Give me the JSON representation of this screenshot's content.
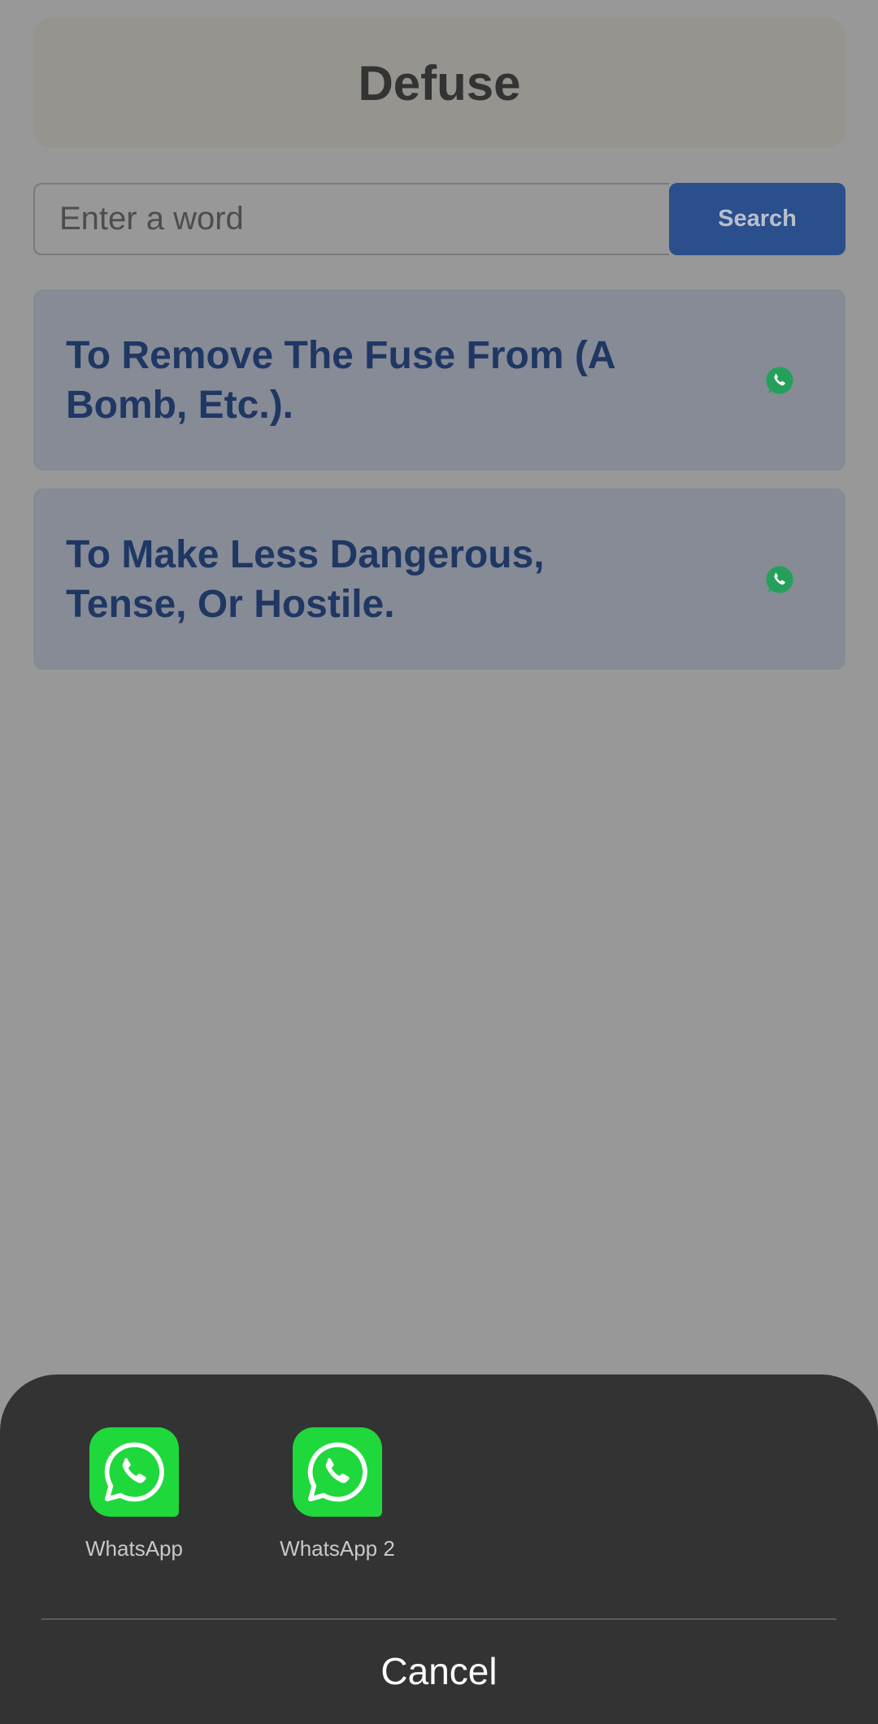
{
  "header": {
    "title": "Defuse"
  },
  "search": {
    "placeholder": "Enter a word",
    "value": "",
    "button_label": "Search"
  },
  "definitions": [
    {
      "text": "To Remove The Fuse From (A Bomb, Etc.).",
      "share_icon": "whatsapp-icon"
    },
    {
      "text": "To Make Less Dangerous, Tense, Or Hostile.",
      "share_icon": "whatsapp-icon"
    }
  ],
  "share_sheet": {
    "targets": [
      {
        "label": "WhatsApp",
        "icon": "whatsapp-icon"
      },
      {
        "label": "WhatsApp 2",
        "icon": "whatsapp-icon"
      }
    ],
    "cancel_label": "Cancel"
  },
  "colors": {
    "accent": "#2b4f8c",
    "definition_text": "#1f3763",
    "whatsapp_green": "#1ed83c",
    "sheet_background": "#333333"
  }
}
